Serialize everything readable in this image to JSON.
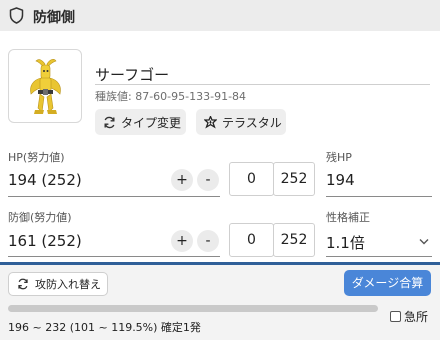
{
  "header": {
    "title": "防御側"
  },
  "pokemon": {
    "name": "サーフゴー",
    "base_stats": "種族値: 87-60-95-133-91-84",
    "type_change_label": "タイプ変更",
    "tera_label": "テラスタル"
  },
  "hp": {
    "label": "HP(努力値)",
    "value": "194 (252)",
    "iv": "0",
    "ev": "252",
    "remaining_label": "残HP",
    "remaining_value": "194"
  },
  "defense": {
    "label": "防御(努力値)",
    "value": "161 (252)",
    "iv": "0",
    "ev": "252",
    "nature_label": "性格補正",
    "nature_value": "1.1倍"
  },
  "controls": {
    "plus": "+",
    "minus": "-"
  },
  "bottom": {
    "swap_label": "攻防入れ替え",
    "calc_label": "ダメージ合算",
    "result": "196 ~ 232 (101 ~ 119.5%) 確定1発",
    "crit_label": "急所",
    "progress_percent": 100
  },
  "colors": {
    "accent_blue": "#4a86d8",
    "divider_blue": "#2f5f98",
    "header_bg": "#ececec"
  },
  "icons": [
    "shield-icon",
    "type-change-icon",
    "tera-icon",
    "swap-icon",
    "chevron-down-icon"
  ]
}
